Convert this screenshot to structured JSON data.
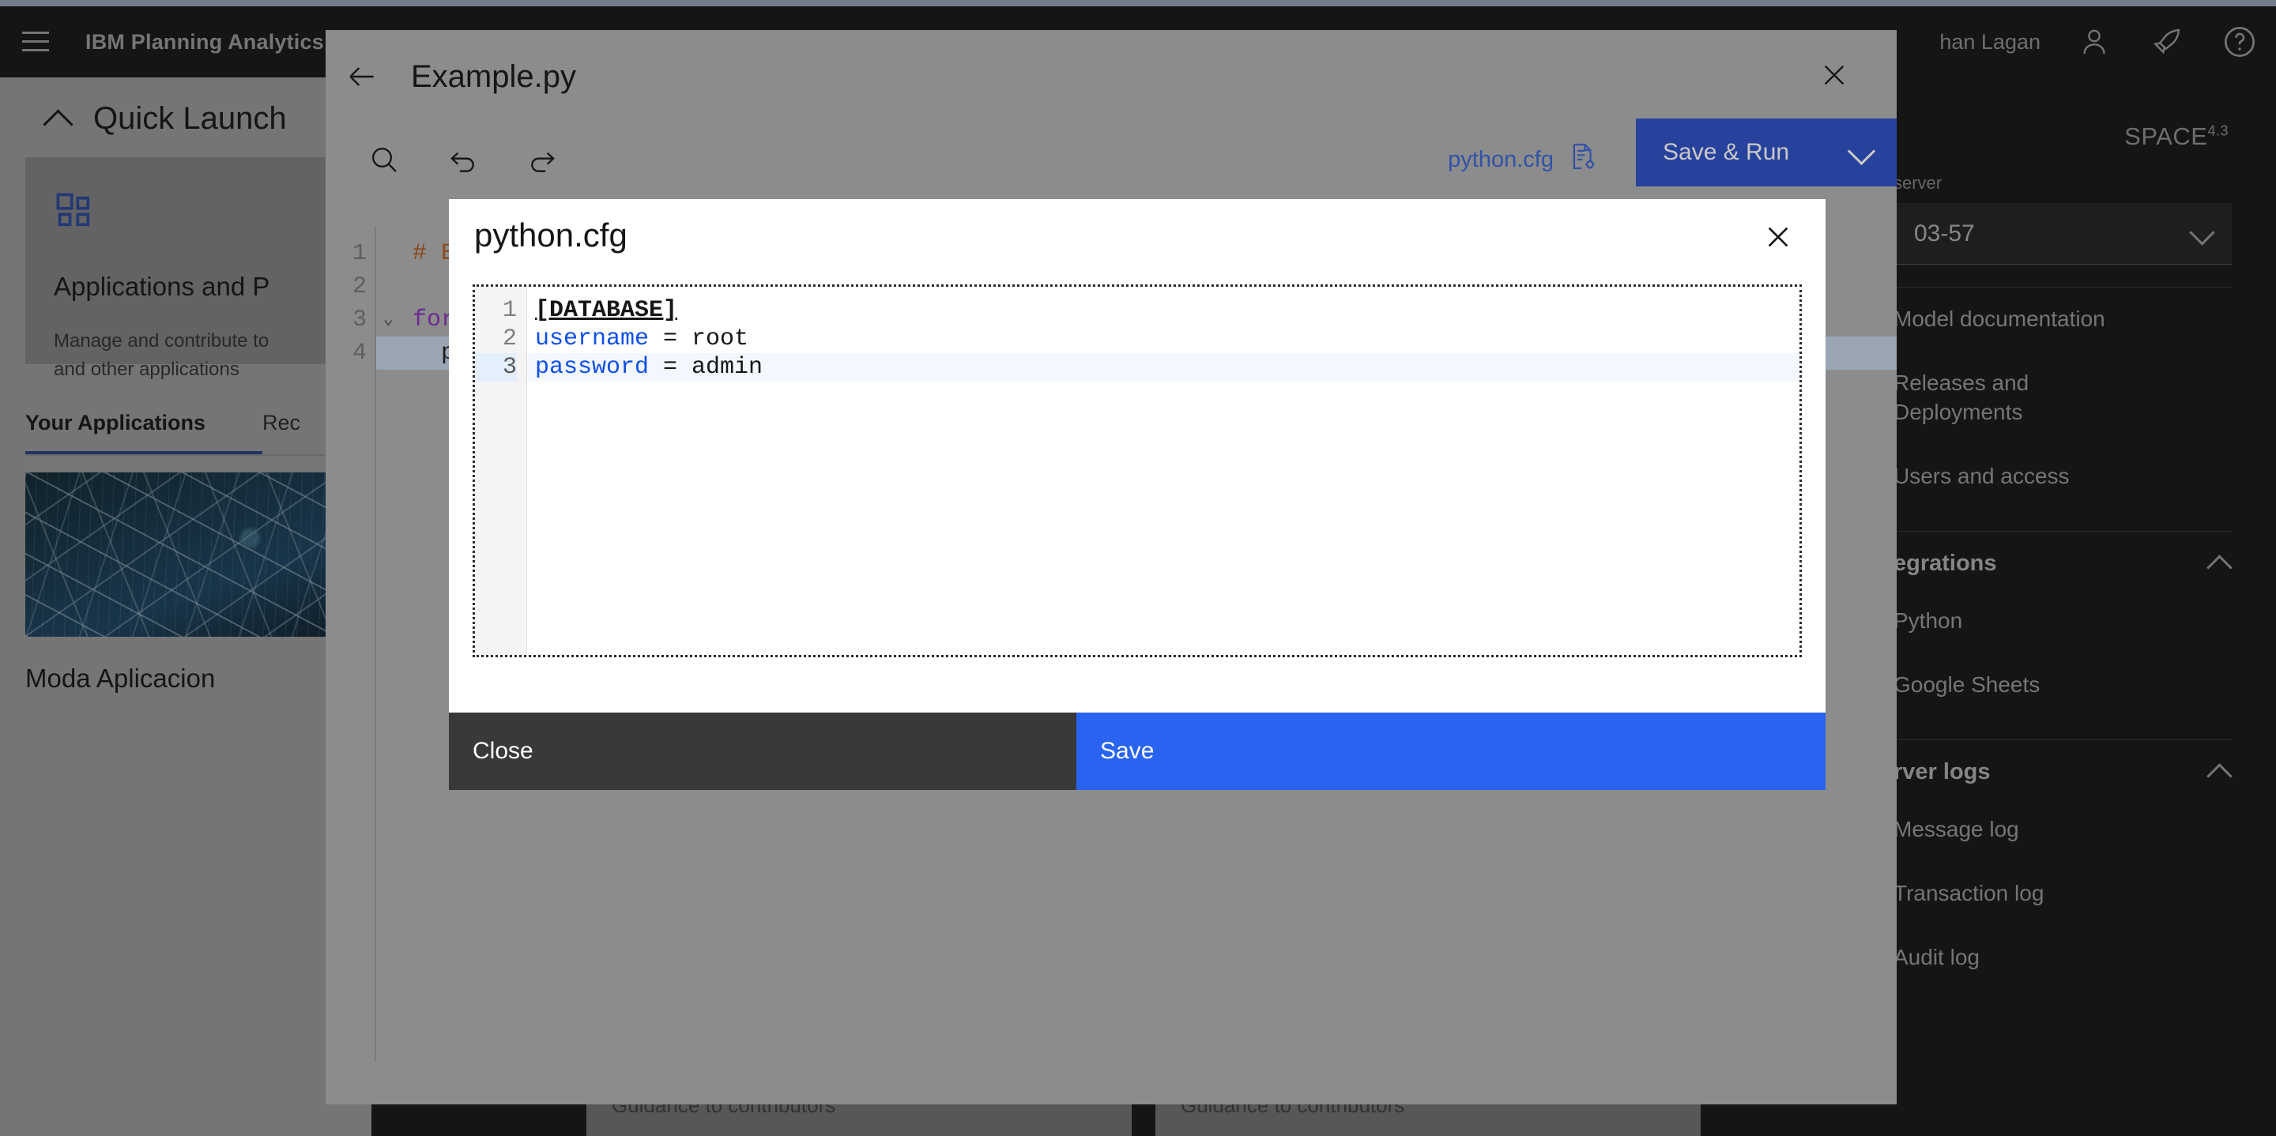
{
  "header": {
    "product_name": "IBM Planning Analytics",
    "user_name": "han Lagan",
    "menu_icon": "hamburger-icon",
    "user_icon": "user-avatar-icon",
    "launch_icon": "rocket-icon",
    "help_icon": "help-circle-icon",
    "space_badge": "SPACE",
    "space_version": "4.3"
  },
  "right_nav": {
    "server_label": "server",
    "server_value": "03-57",
    "items": [
      {
        "label": "Model documentation"
      },
      {
        "label": "Releases and\nDeployments"
      },
      {
        "label": "Users and access"
      }
    ],
    "sections": [
      {
        "title": "egrations",
        "items": [
          {
            "label": "Python"
          },
          {
            "label": "Google Sheets"
          }
        ]
      },
      {
        "title": "rver logs",
        "items": [
          {
            "label": "Message log"
          },
          {
            "label": "Transaction log"
          },
          {
            "label": "Audit log"
          }
        ]
      }
    ]
  },
  "dashboard": {
    "quick_launch_title": "Quick Launch",
    "tile": {
      "icon": "apps-grid-icon",
      "title": "Applications and P",
      "description_line1": "Manage and contribute to ",
      "description_line2": "and other applications"
    },
    "tabs": [
      {
        "label": "Your Applications",
        "active": true
      },
      {
        "label": "Rec",
        "active": false
      }
    ],
    "app_card": {
      "thumbnail_alt": "network-lines-thumbnail",
      "title": "Moda Aplicacion"
    },
    "guidance_label_left": "Guidance to contributors",
    "guidance_label_right": "Guidance to contributors"
  },
  "editor": {
    "back_icon": "arrow-left-icon",
    "title": "Example.py",
    "close_icon": "close-icon",
    "toolbar": {
      "search_icon": "search-icon",
      "undo_icon": "undo-icon",
      "redo_icon": "redo-icon"
    },
    "cfg_link_label": "python.cfg",
    "cfg_link_icon": "document-settings-icon",
    "save_run_label": "Save & Run",
    "save_run_chevron": "chevron-down-icon",
    "code_lines": [
      {
        "num": "1",
        "text": "# Ex",
        "kind": "comment",
        "fold": false,
        "highlight": false
      },
      {
        "num": "2",
        "text": "",
        "kind": "plain",
        "fold": false,
        "highlight": false
      },
      {
        "num": "3",
        "text": "for",
        "kind": "keyword",
        "fold": true,
        "highlight": false
      },
      {
        "num": "4",
        "text": "  pr",
        "kind": "plain",
        "fold": false,
        "highlight": true
      }
    ]
  },
  "modal": {
    "title": "python.cfg",
    "close_icon": "close-icon",
    "code": [
      {
        "num": "1",
        "section": "[DATABASE]",
        "active": false
      },
      {
        "num": "2",
        "key": "username",
        "rest": " = root",
        "active": false
      },
      {
        "num": "3",
        "key": "password",
        "rest": " = admin",
        "active": true
      }
    ],
    "close_label": "Close",
    "save_label": "Save"
  },
  "colors": {
    "accent_blue": "#2864f0",
    "brand_blue": "#27429c",
    "link_blue": "#3252a8",
    "dark": "#161616"
  }
}
